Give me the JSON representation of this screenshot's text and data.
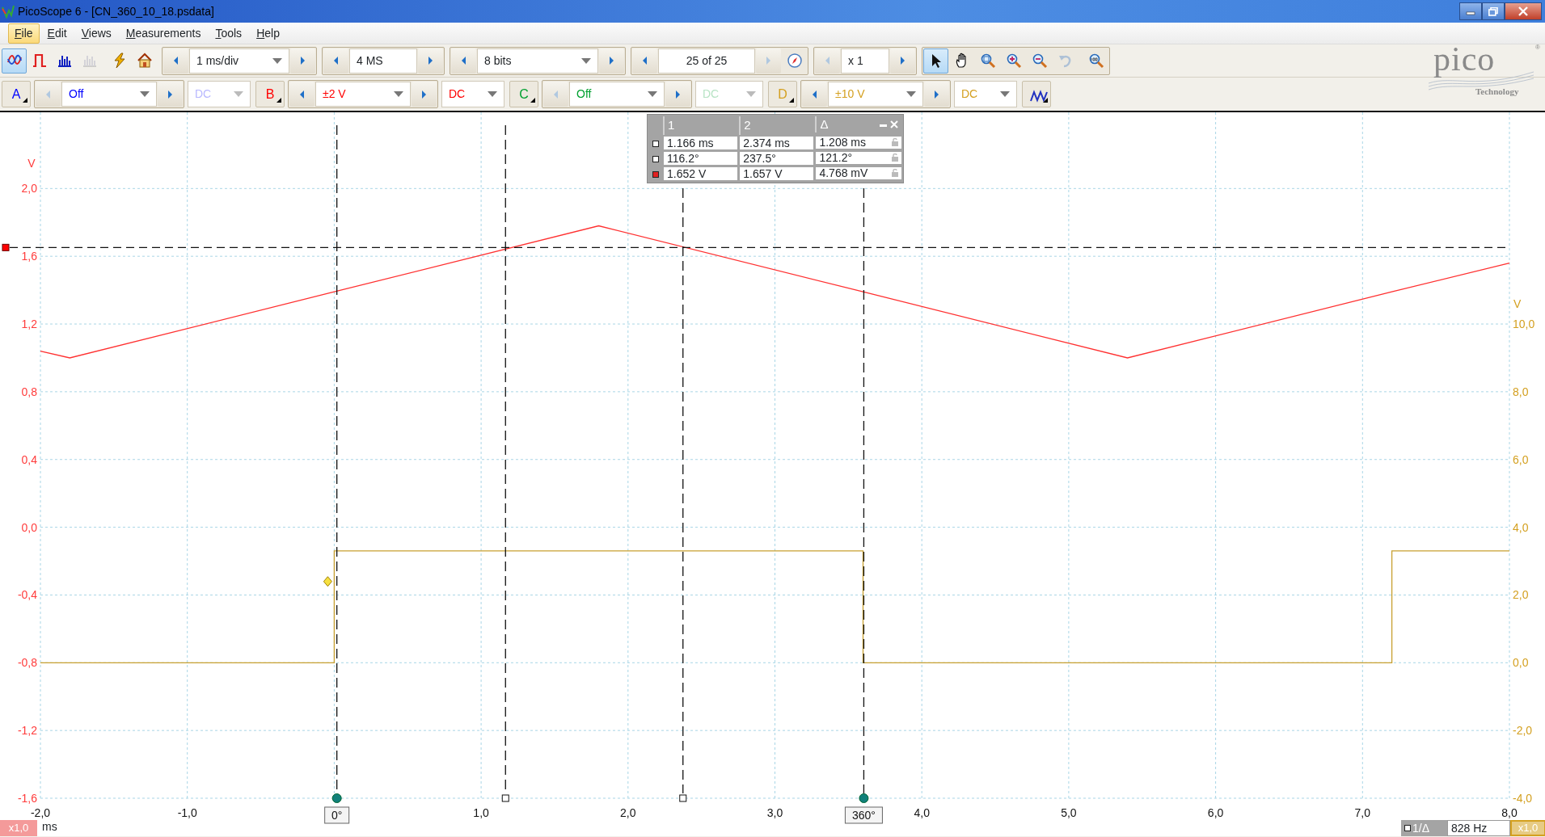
{
  "window": {
    "title": "PicoScope 6 - [CN_360_10_18.psdata]"
  },
  "menu": [
    {
      "label": "File",
      "selected": true
    },
    {
      "label": "Edit",
      "selected": false
    },
    {
      "label": "Views",
      "selected": false
    },
    {
      "label": "Measurements",
      "selected": false
    },
    {
      "label": "Tools",
      "selected": false
    },
    {
      "label": "Help",
      "selected": false
    }
  ],
  "modes": [
    {
      "kind": "scope",
      "selected": true,
      "disabled": false
    },
    {
      "kind": "persistence",
      "selected": false,
      "disabled": false
    },
    {
      "kind": "spectrum",
      "selected": false,
      "disabled": false
    },
    {
      "kind": "spectrum-persistence",
      "selected": false,
      "disabled": true
    },
    {
      "kind": "auto-setup",
      "selected": false,
      "disabled": false
    },
    {
      "kind": "default-setup",
      "selected": false,
      "disabled": false
    }
  ],
  "timebase": {
    "value": "1 ms/div",
    "prev_enabled": true,
    "next_enabled": true
  },
  "samples": {
    "value": "4 MS",
    "prev_enabled": true,
    "next_enabled": true
  },
  "resolution": {
    "value": "8 bits",
    "prev_enabled": true,
    "next_enabled": true
  },
  "buffer": {
    "value": "25 of 25",
    "prev_enabled": true,
    "next_enabled": false
  },
  "zoom": {
    "value": "x 1",
    "prev_enabled": false,
    "next_enabled": true
  },
  "tools": [
    {
      "kind": "pointer",
      "selected": true,
      "disabled": false
    },
    {
      "kind": "hand",
      "selected": false,
      "disabled": false
    },
    {
      "kind": "zoom-fit",
      "selected": false,
      "disabled": false
    },
    {
      "kind": "zoom-in",
      "selected": false,
      "disabled": false
    },
    {
      "kind": "zoom-out",
      "selected": false,
      "disabled": false
    },
    {
      "kind": "undo-zoom",
      "selected": false,
      "disabled": true
    },
    {
      "kind": "zoom-100",
      "selected": false,
      "disabled": false
    }
  ],
  "logo": {
    "name": "pico",
    "mark": "®",
    "tagline": "Technology"
  },
  "channels": [
    {
      "letter": "A",
      "color": "#0000ff",
      "range": "Off",
      "coupling": "DC",
      "enabled": false,
      "prev_enabled": false,
      "next_enabled": true
    },
    {
      "letter": "B",
      "color": "#ff0000",
      "range": "±2 V",
      "coupling": "DC",
      "enabled": true,
      "prev_enabled": true,
      "next_enabled": true
    },
    {
      "letter": "C",
      "color": "#00a030",
      "range": "Off",
      "coupling": "DC",
      "enabled": false,
      "prev_enabled": false,
      "next_enabled": true
    },
    {
      "letter": "D",
      "color": "#d4a020",
      "range": "±10 V",
      "coupling": "DC",
      "enabled": true,
      "prev_enabled": true,
      "next_enabled": true
    }
  ],
  "measurements": {
    "columns": [
      "1",
      "2",
      "Δ"
    ],
    "rows": [
      {
        "color": "#ffffff",
        "values": [
          "1.166 ms",
          "2.374 ms",
          "1.208 ms"
        ]
      },
      {
        "color": "#ffffff",
        "values": [
          "116.2°",
          "237.5°",
          "121.2°"
        ]
      },
      {
        "color": "#e02020",
        "values": [
          "1.652 V",
          "1.657 V",
          "4.768 mV"
        ]
      }
    ]
  },
  "chart_data": {
    "type": "line",
    "xlabel": "ms",
    "ylabel": "V",
    "y2label": "V",
    "x": [
      -2.0,
      -1.8,
      0,
      0,
      1.8,
      3.6,
      3.6,
      5.4,
      7.2,
      7.2,
      8.0
    ],
    "series": [
      {
        "color": "#ff3030",
        "values": [
          1.04,
          1.0,
          1.39,
          1.39,
          1.78,
          1.39,
          1.39,
          1.0,
          1.39,
          1.39,
          1.56
        ]
      },
      {
        "color": "#c8a030",
        "axis": "y2",
        "values": [
          0,
          0,
          0,
          3.3,
          3.3,
          3.3,
          0,
          0,
          0,
          3.3,
          3.3
        ]
      }
    ],
    "xlim": [
      -2,
      8
    ],
    "ylim": [
      -1.6,
      2.45
    ],
    "y2lim": [
      -4,
      16.25
    ],
    "grid": true,
    "xticks": [
      {
        "value": -2,
        "label": "-2,0"
      },
      {
        "value": -1,
        "label": "-1,0"
      },
      {
        "value": 1,
        "label": "1,0"
      },
      {
        "value": 2,
        "label": "2,0"
      },
      {
        "value": 3,
        "label": "3,0"
      },
      {
        "value": 4,
        "label": "4,0"
      },
      {
        "value": 5,
        "label": "5,0"
      },
      {
        "value": 6,
        "label": "6,0"
      },
      {
        "value": 7,
        "label": "7,0"
      },
      {
        "value": 8,
        "label": "8,0"
      }
    ],
    "yticks": [
      {
        "value": 2.0,
        "label": "2,0"
      },
      {
        "value": 1.6,
        "label": "1,6"
      },
      {
        "value": 1.2,
        "label": "1,2"
      },
      {
        "value": 0.8,
        "label": "0,8"
      },
      {
        "value": 0.4,
        "label": "0,4"
      },
      {
        "value": 0,
        "label": "0,0"
      },
      {
        "value": -0.4,
        "label": "-0,4"
      },
      {
        "value": -0.8,
        "label": "-0,8"
      },
      {
        "value": -1.2,
        "label": "-1,2"
      },
      {
        "value": -1.6,
        "label": "-1,6"
      }
    ],
    "y2ticks": [
      {
        "value": 10,
        "label": "10,0"
      },
      {
        "value": 8,
        "label": "8,0"
      },
      {
        "value": 6,
        "label": "6,0"
      },
      {
        "value": 4,
        "label": "4,0"
      },
      {
        "value": 2,
        "label": "2,0"
      },
      {
        "value": 0,
        "label": "0,0"
      },
      {
        "value": -2,
        "label": "-2,0"
      },
      {
        "value": -4,
        "label": "-4,0"
      }
    ]
  },
  "cursors": [
    {
      "kind": "level",
      "level": 0.8029
    },
    {
      "kind": "phase",
      "level": 0.2018,
      "text": "0°"
    },
    {
      "kind": "time",
      "level": 0.3166
    },
    {
      "kind": "time",
      "level": 0.4374
    },
    {
      "kind": "phase",
      "level": 0.5605,
      "text": "360°"
    },
    {
      "kind": "trigger",
      "level": 0.316
    }
  ],
  "x_scale": "x1,0",
  "right_scale": "x1,0",
  "frequency": {
    "label": "1/Δ",
    "value": "828 Hz"
  }
}
